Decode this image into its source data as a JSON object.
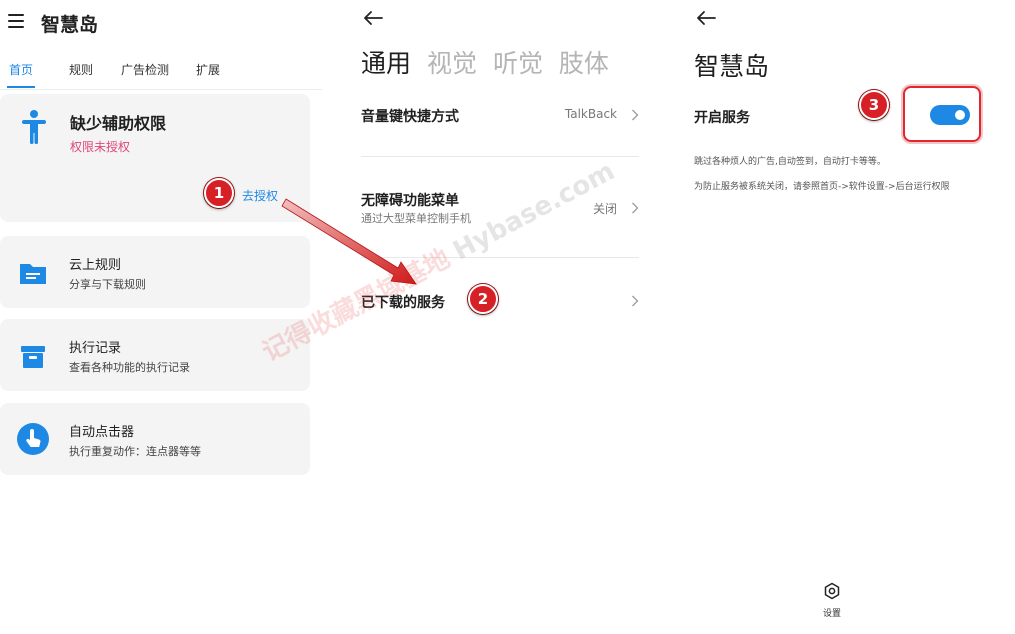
{
  "panel1": {
    "title": "智慧岛",
    "tabs": [
      "首页",
      "规则",
      "广告检测",
      "扩展"
    ],
    "active_tab": 0,
    "permission_card": {
      "title": "缺少辅助权限",
      "subtitle": "权限未授权",
      "action": "去授权"
    },
    "items": [
      {
        "title": "云上规则",
        "subtitle": "分享与下载规则",
        "icon": "folder-icon"
      },
      {
        "title": "执行记录",
        "subtitle": "查看各种功能的执行记录",
        "icon": "archive-icon"
      },
      {
        "title": "自动点击器",
        "subtitle": "执行重复动作：连点器等等",
        "icon": "tap-icon"
      }
    ]
  },
  "panel2": {
    "category_tabs": [
      "通用",
      "视觉",
      "听觉",
      "肢体"
    ],
    "active_category": 0,
    "rows": [
      {
        "title": "音量键快捷方式",
        "subtitle": "",
        "value": "TalkBack"
      },
      {
        "title": "无障碍功能菜单",
        "subtitle": "通过大型菜单控制手机",
        "value": "关闭"
      },
      {
        "title": "已下载的服务",
        "subtitle": "",
        "value": ""
      }
    ]
  },
  "panel3": {
    "title": "智慧岛",
    "service_label": "开启服务",
    "service_enabled": true,
    "descriptions": [
      "跳过各种烦人的广告,自动签到，自动打卡等等。",
      "为防止服务被系统关闭，请参照首页->软件设置->后台运行权限"
    ],
    "settings_label": "设置"
  },
  "annotations": {
    "step1": "1",
    "step2": "2",
    "step3": "3"
  },
  "watermark": {
    "cn": "记得收藏黑域基地",
    "en": "Hybase.com"
  },
  "colors": {
    "accent": "#1e88e5",
    "warning_text": "#e0457b",
    "badge": "#d71f26",
    "card_bg": "#f4f4f4"
  }
}
